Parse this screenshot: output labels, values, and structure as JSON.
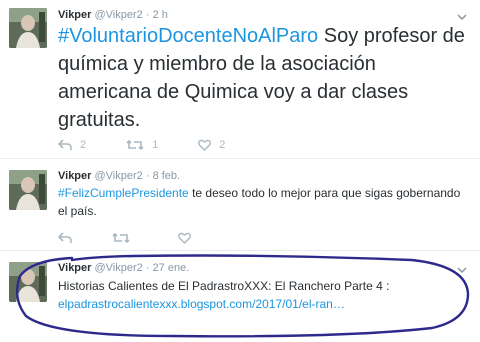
{
  "tweets": [
    {
      "name": "Vikper",
      "handle": "@Vikper2",
      "time": "2 h",
      "hashtag": "#VoluntarioDocenteNoAlParo",
      "text": " Soy profesor de química y miembro de la asociación americana de Quimica voy a dar clases gratuitas.",
      "reply_count": "2",
      "retweet_count": "1",
      "like_count": "2"
    },
    {
      "name": "Vikper",
      "handle": "@Vikper2",
      "time": "8 feb.",
      "hashtag": "#FelizCumplePresidente",
      "text": " te deseo todo lo mejor para que sigas gobernando el país."
    },
    {
      "name": "Vikper",
      "handle": "@Vikper2",
      "time": "27 ene.",
      "text": "Historias Calientes de El PadrastroXXX: El Ranchero Parte 4 :",
      "link": "elpadrastrocalientexxx.blogspot.com/2017/01/el-ran…"
    }
  ],
  "icons": {
    "reply": "reply-icon",
    "retweet": "retweet-icon",
    "like": "heart-icon",
    "more": "chevron-down-icon"
  },
  "colors": {
    "link": "#1b95e0",
    "muted": "#8899a6",
    "action": "#aab8c2",
    "annotation": "#2e2a8c"
  }
}
